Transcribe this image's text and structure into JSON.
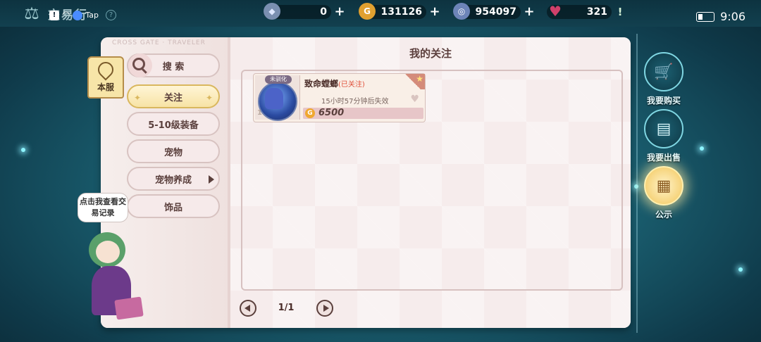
{
  "topbar": {
    "app_title": "交易行",
    "status_tap_label": "Tap",
    "help_label": "?",
    "resources": [
      {
        "name": "diamond",
        "value": "0",
        "icon": "gem-icon",
        "color": "#7a8fb0",
        "action": "plus"
      },
      {
        "name": "gold",
        "value": "131126",
        "icon": "gold-coin-icon",
        "color": "#e0a030",
        "action": "plus"
      },
      {
        "name": "crystal",
        "value": "954097",
        "icon": "blue-coin-icon",
        "color": "#6d84b8",
        "action": "plus"
      },
      {
        "name": "hearts",
        "value": "321",
        "icon": "heart-icon",
        "color": "#c0406a",
        "action": "excl"
      }
    ],
    "time": "9:06"
  },
  "book": {
    "brand": "CROSS GATE · TRAVELER",
    "page_title": "我的关注"
  },
  "region": {
    "label": "本服"
  },
  "categories": [
    {
      "label": "搜 索",
      "type": "search"
    },
    {
      "label": "关注",
      "type": "active"
    },
    {
      "label": "5-10级装备",
      "type": "normal"
    },
    {
      "label": "宠物",
      "type": "normal"
    },
    {
      "label": "宠物养成",
      "type": "arrow"
    },
    {
      "label": "饰品",
      "type": "normal"
    }
  ],
  "item": {
    "badge": "未驯化",
    "level_text": "1",
    "name": "致命螳螂",
    "tag": "(已关注)",
    "expire": "15小时57分钟后失效",
    "price": "6500",
    "coin_label": "G"
  },
  "pagination": {
    "text": "1/1"
  },
  "right_nav": [
    {
      "label": "我要购买",
      "icon": "cart-icon",
      "glyph": "🛒"
    },
    {
      "label": "我要出售",
      "icon": "sell-card-icon",
      "glyph": "▤"
    },
    {
      "label": "公示",
      "icon": "notice-board-icon",
      "glyph": "▦"
    }
  ],
  "bubble": {
    "text": "点击我查看交易记录"
  }
}
